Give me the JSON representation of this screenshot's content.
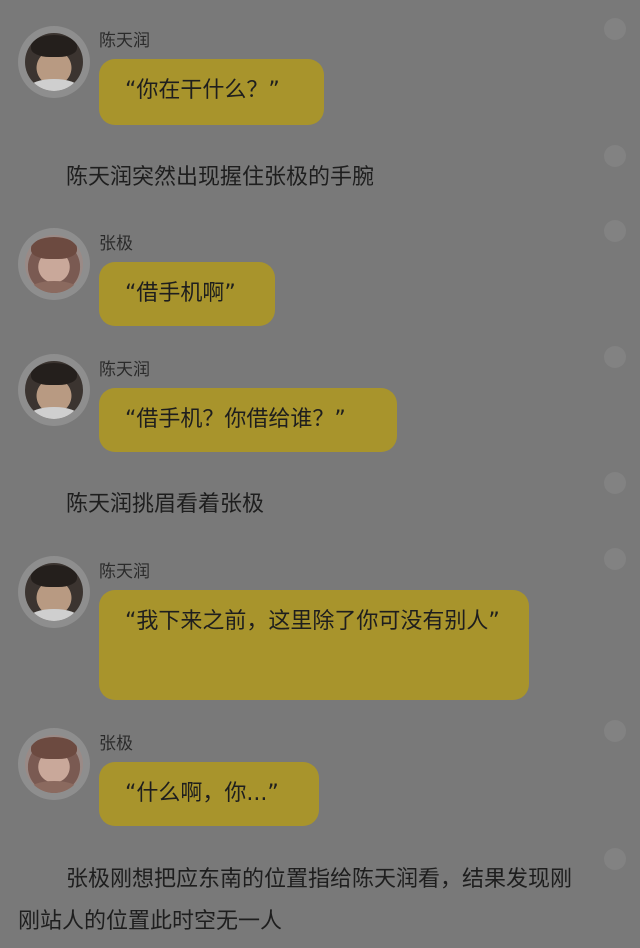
{
  "messages": [
    {
      "type": "chat",
      "speaker": "陈天润",
      "text": "“你在干什么？”"
    },
    {
      "type": "narration",
      "text": "陈天润突然出现握住张极的手腕"
    },
    {
      "type": "chat",
      "speaker": "张极",
      "text": "“借手机啊”"
    },
    {
      "type": "chat",
      "speaker": "陈天润",
      "text": "“借手机？你借给谁？”"
    },
    {
      "type": "narration",
      "text": "陈天润挑眉看着张极"
    },
    {
      "type": "chat",
      "speaker": "陈天润",
      "text": "“我下来之前，这里除了你可没有别人”"
    },
    {
      "type": "chat",
      "speaker": "张极",
      "text": "“什么啊，你...”"
    },
    {
      "type": "narration",
      "text": "张极刚想把应东南的位置指给陈天润看，结果发现刚刚站人的位置此时空无一人"
    }
  ],
  "colors": {
    "background": "#797979",
    "bubble": "#a8942c"
  }
}
